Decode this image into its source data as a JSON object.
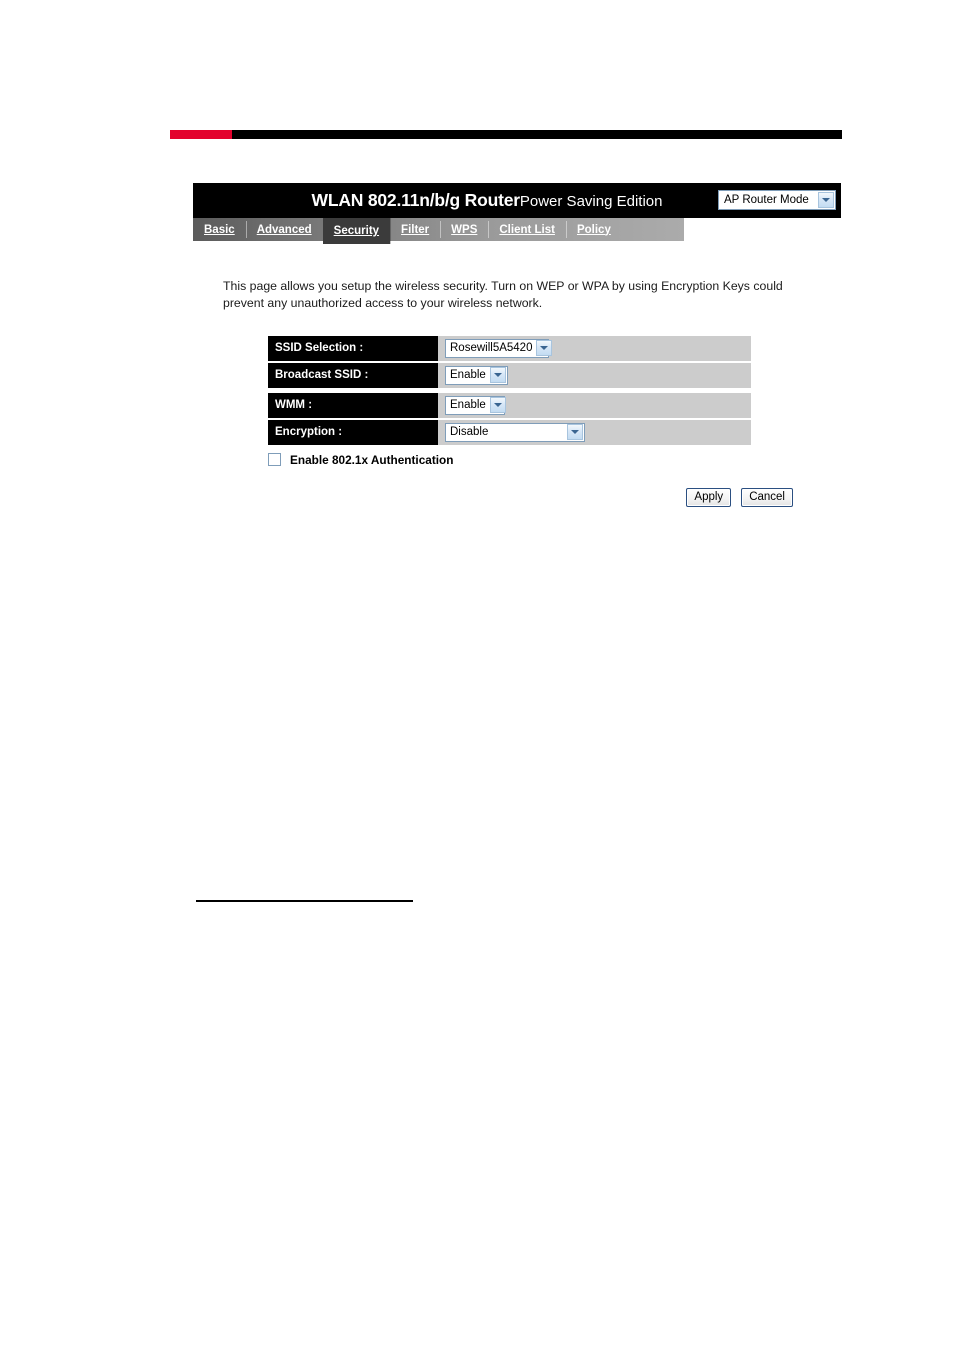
{
  "header": {
    "title_main": "WLAN 802.11n/b/g Router",
    "title_sub": "Power Saving Edition",
    "mode_selected": "AP Router Mode",
    "mode_icon": "chevron-down-icon"
  },
  "tabs": [
    {
      "label": "Basic",
      "active": false
    },
    {
      "label": "Advanced",
      "active": false
    },
    {
      "label": "Security",
      "active": true
    },
    {
      "label": "Filter",
      "active": false
    },
    {
      "label": "WPS",
      "active": false
    },
    {
      "label": "Client List",
      "active": false
    },
    {
      "label": "Policy",
      "active": false
    }
  ],
  "description": "This page allows you setup the wireless security. Turn on WEP or WPA by using Encryption Keys could prevent any unauthorized access to your wireless network.",
  "settings": [
    {
      "label": "SSID Selection :",
      "value": "Rosewill5A5420"
    },
    {
      "label": "Broadcast SSID :",
      "value": "Enable"
    },
    {
      "label": "WMM :",
      "value": "Enable"
    },
    {
      "label": "Encryption :",
      "value": "Disable"
    }
  ],
  "auth_checkbox": {
    "label": "Enable 802.1x Authentication",
    "checked": false
  },
  "buttons": {
    "apply": "Apply",
    "cancel": "Cancel"
  },
  "colors": {
    "accent_red": "#e3032e",
    "header_black": "#000000",
    "value_cell_gray": "#cccccc",
    "active_tab": "#3b3b3b"
  }
}
